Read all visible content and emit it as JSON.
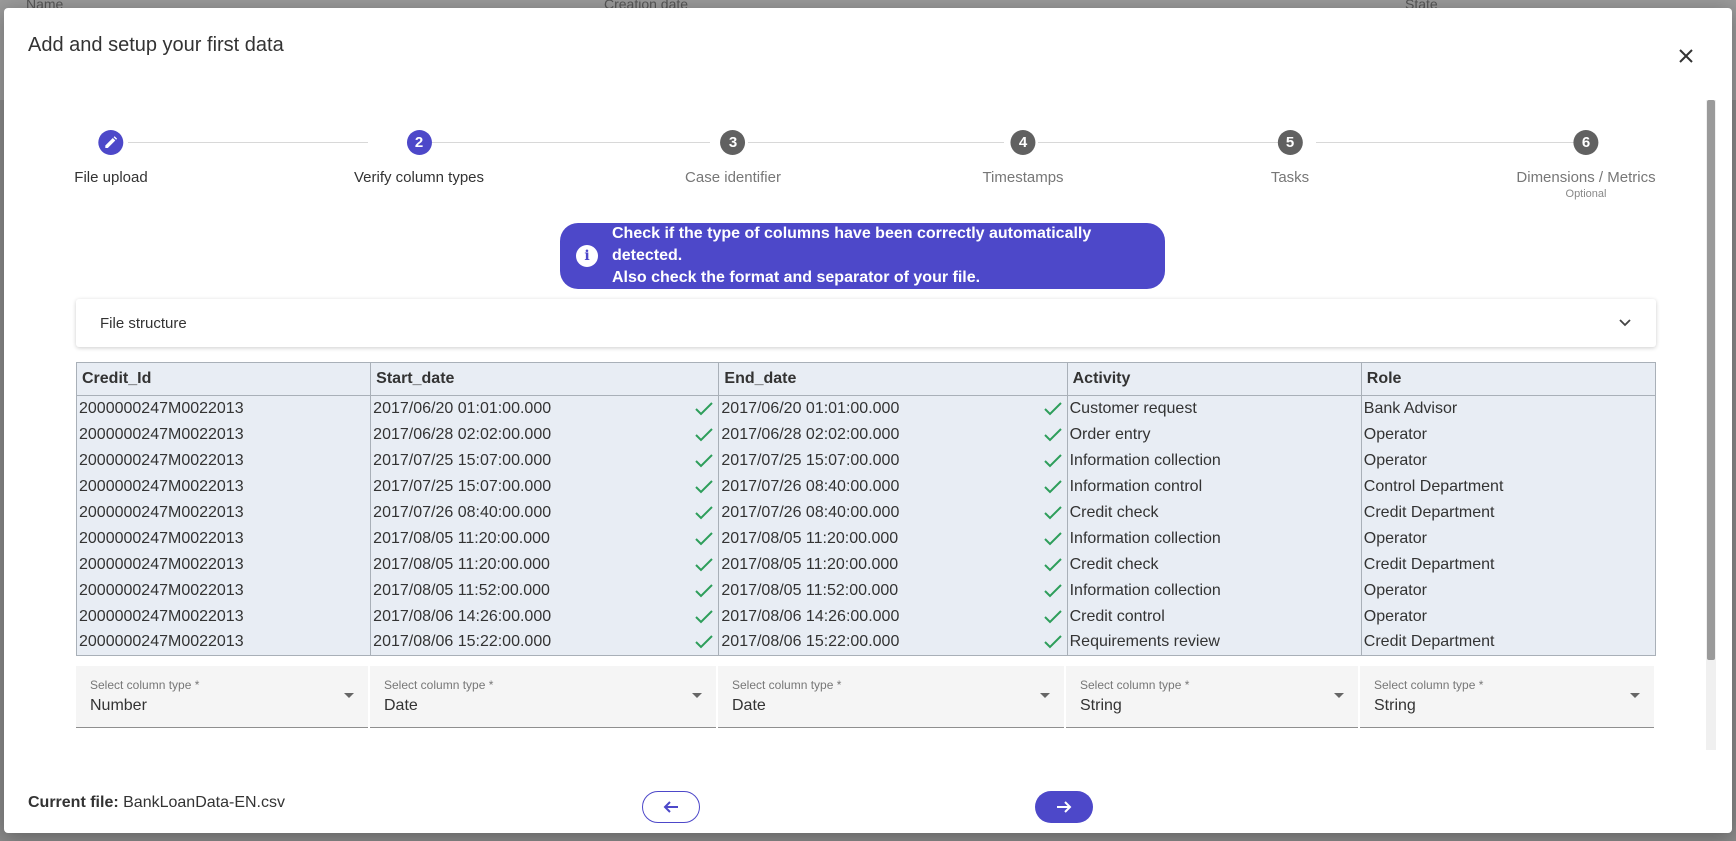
{
  "background": {
    "columns": [
      "Name",
      "Creation date",
      "State"
    ]
  },
  "modal": {
    "title": "Add and setup your first data"
  },
  "steps": [
    {
      "number": "",
      "label": "File upload",
      "sub": "",
      "state": "done"
    },
    {
      "number": "2",
      "label": "Verify column types",
      "sub": "",
      "state": "active"
    },
    {
      "number": "3",
      "label": "Case identifier",
      "sub": "",
      "state": "pending"
    },
    {
      "number": "4",
      "label": "Timestamps",
      "sub": "",
      "state": "pending"
    },
    {
      "number": "5",
      "label": "Tasks",
      "sub": "",
      "state": "pending"
    },
    {
      "number": "6",
      "label": "Dimensions / Metrics",
      "sub": "Optional",
      "state": "pending"
    }
  ],
  "info": {
    "line1": "Check if the type of columns have been correctly automatically detected.",
    "line2": "Also check the format and separator of your file."
  },
  "accordion": {
    "label": "File structure"
  },
  "table": {
    "headers": [
      "Credit_Id",
      "Start_date",
      "End_date",
      "Activity",
      "Role"
    ],
    "rows": [
      [
        "2000000247M0022013",
        "2017/06/20 01:01:00.000",
        "2017/06/20 01:01:00.000",
        "Customer request",
        "Bank Advisor"
      ],
      [
        "2000000247M0022013",
        "2017/06/28 02:02:00.000",
        "2017/06/28 02:02:00.000",
        "Order entry",
        "Operator"
      ],
      [
        "2000000247M0022013",
        "2017/07/25 15:07:00.000",
        "2017/07/25 15:07:00.000",
        "Information collection",
        "Operator"
      ],
      [
        "2000000247M0022013",
        "2017/07/25 15:07:00.000",
        "2017/07/26 08:40:00.000",
        "Information control",
        "Control Department"
      ],
      [
        "2000000247M0022013",
        "2017/07/26 08:40:00.000",
        "2017/07/26 08:40:00.000",
        "Credit check",
        "Credit Department"
      ],
      [
        "2000000247M0022013",
        "2017/08/05 11:20:00.000",
        "2017/08/05 11:20:00.000",
        "Information collection",
        "Operator"
      ],
      [
        "2000000247M0022013",
        "2017/08/05 11:20:00.000",
        "2017/08/05 11:20:00.000",
        "Credit check",
        "Credit Department"
      ],
      [
        "2000000247M0022013",
        "2017/08/05 11:52:00.000",
        "2017/08/05 11:52:00.000",
        "Information collection",
        "Operator"
      ],
      [
        "2000000247M0022013",
        "2017/08/06 14:26:00.000",
        "2017/08/06 14:26:00.000",
        "Credit control",
        "Operator"
      ],
      [
        "2000000247M0022013",
        "2017/08/06 15:22:00.000",
        "2017/08/06 15:22:00.000",
        "Requirements review",
        "Credit Department"
      ]
    ]
  },
  "selects": [
    {
      "label": "Select column type *",
      "value": "Number"
    },
    {
      "label": "Select column type *",
      "value": "Date"
    },
    {
      "label": "Select column type *",
      "value": "Date"
    },
    {
      "label": "Select column type *",
      "value": "String"
    },
    {
      "label": "Select column type *",
      "value": "String"
    }
  ],
  "footer": {
    "current_label": "Current file:",
    "current_value": "BankLoanData-EN.csv"
  },
  "colors": {
    "accent": "#4d48c9",
    "step_pending": "#616161",
    "check": "#2e9e5b",
    "table_bg": "#e8edf4"
  },
  "icons": {
    "close": "close-icon",
    "edit": "pencil-icon",
    "info": "info-icon",
    "chevron": "chevron-down-icon",
    "check": "check-icon",
    "back": "arrow-left-icon",
    "next": "arrow-right-icon"
  }
}
